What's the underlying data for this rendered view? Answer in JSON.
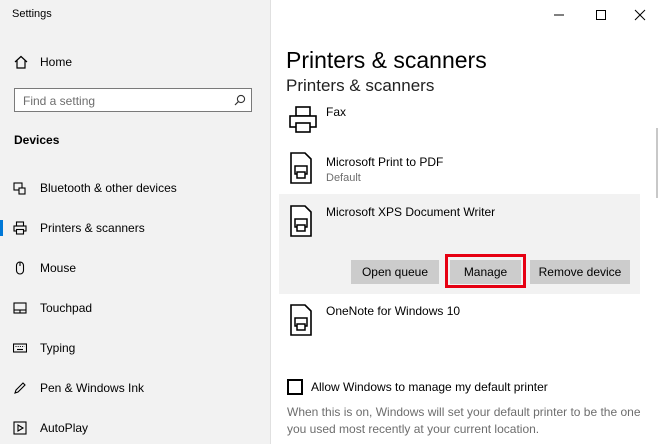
{
  "window": {
    "title": "Settings"
  },
  "sidebar": {
    "home_label": "Home",
    "search_placeholder": "Find a setting",
    "section_label": "Devices",
    "items": [
      {
        "label": "Bluetooth & other devices",
        "icon": "bluetooth-devices-icon"
      },
      {
        "label": "Printers & scanners",
        "icon": "printer-icon",
        "active": true
      },
      {
        "label": "Mouse",
        "icon": "mouse-icon"
      },
      {
        "label": "Touchpad",
        "icon": "touchpad-icon"
      },
      {
        "label": "Typing",
        "icon": "keyboard-icon"
      },
      {
        "label": "Pen & Windows Ink",
        "icon": "pen-icon"
      },
      {
        "label": "AutoPlay",
        "icon": "autoplay-icon"
      }
    ]
  },
  "main": {
    "title": "Printers & scanners",
    "subtitle": "Printers & scanners",
    "printers": [
      {
        "name": "Fax",
        "status": "",
        "icon": "fax-icon"
      },
      {
        "name": "Microsoft Print to PDF",
        "status": "Default",
        "icon": "printer-icon"
      },
      {
        "name": "Microsoft XPS Document Writer",
        "status": "",
        "icon": "printer-icon",
        "selected": true
      },
      {
        "name": "OneNote for Windows 10",
        "status": "",
        "icon": "printer-icon"
      }
    ],
    "actions": {
      "open_queue": "Open queue",
      "manage": "Manage",
      "remove_device": "Remove device"
    },
    "default_printer_checkbox": {
      "label": "Allow Windows to manage my default printer",
      "checked": false
    },
    "description": "When this is on, Windows will set your default printer to be the one you used most recently at your current location."
  },
  "colors": {
    "sidebar_bg": "#f2f2f2",
    "accent": "#0078d7",
    "button_bg": "#cccccc",
    "highlight": "#e60012"
  }
}
